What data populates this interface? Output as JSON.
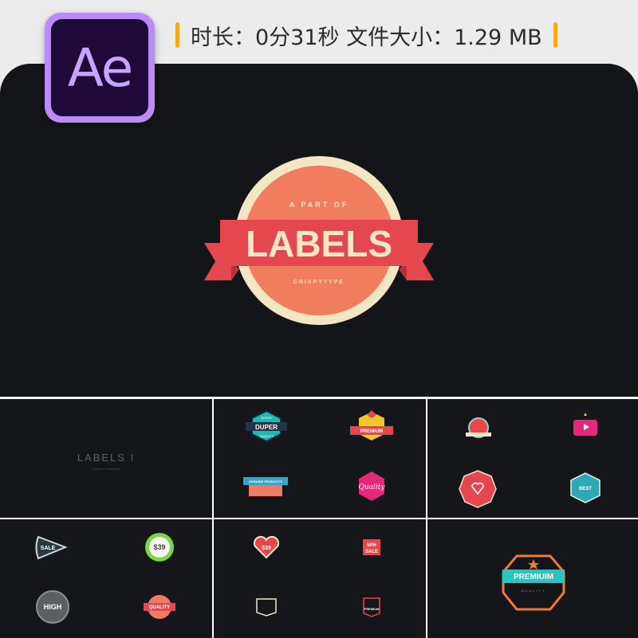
{
  "header": {
    "app_icon": "after-effects-logo",
    "app_abbrev": "Ae",
    "info_text": "时长：0分31秒  文件大小：1.29 MB",
    "accent_color": "#f7a81b"
  },
  "hero": {
    "kicker": "A PART OF",
    "title": "LABELS",
    "subtitle": "CRISPYTYPE",
    "background": "#141518",
    "colors": {
      "badge_outer": "#f3e6c3",
      "badge_inner": "#ef7d5e",
      "ribbon": "#e5474f",
      "ribbon_fold": "#b8323b",
      "text": "#f6e7c6"
    }
  },
  "thumbnails": [
    {
      "name": "LABELS I",
      "caption": "A part of CrispyType"
    },
    {
      "labels": [
        "SUPER",
        "DUPER",
        "QUALITY",
        "PREMIUM",
        "GENUINE PRODUCTS",
        "Quality"
      ]
    },
    {
      "labels": [
        "BEST"
      ]
    },
    {
      "labels": [
        "SALE",
        "$39",
        "HIGH",
        "QUALITY"
      ]
    },
    {
      "labels": [
        "$39",
        "50%",
        "SALE",
        "PREMIUM"
      ]
    },
    {
      "labels": [
        "PREMIUIM",
        "QUALITY"
      ]
    }
  ]
}
